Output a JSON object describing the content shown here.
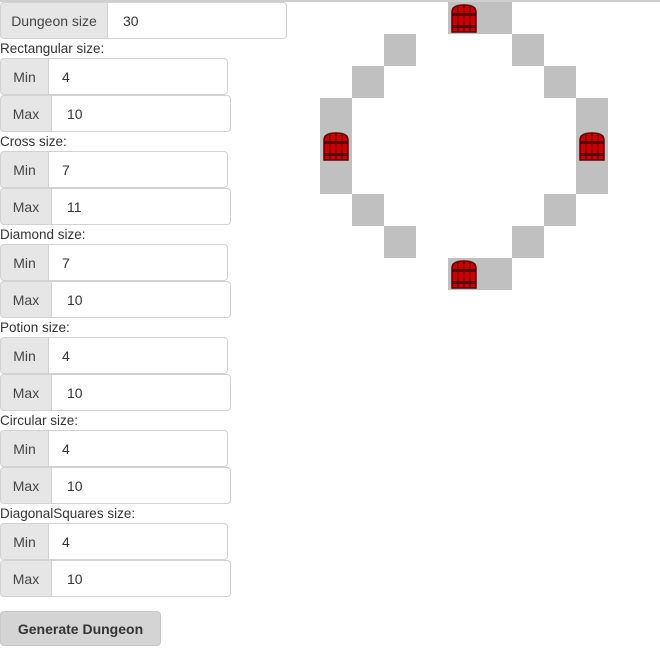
{
  "dungeon": {
    "label": "Dungeon size",
    "value": "30"
  },
  "shapes": [
    {
      "label": "Rectangular size:",
      "min_label": "Min",
      "min": "4",
      "max_label": "Max",
      "max": "10"
    },
    {
      "label": "Cross size:",
      "min_label": "Min",
      "min": "7",
      "max_label": "Max",
      "max": "11"
    },
    {
      "label": "Diamond size:",
      "min_label": "Min",
      "min": "7",
      "max_label": "Max",
      "max": "10"
    },
    {
      "label": "Potion size:",
      "min_label": "Min",
      "min": "4",
      "max_label": "Max",
      "max": "10"
    },
    {
      "label": "Circular size:",
      "min_label": "Min",
      "min": "4",
      "max_label": "Max",
      "max": "10"
    },
    {
      "label": "DiagonalSquares size:",
      "min_label": "Min",
      "min": "4",
      "max_label": "Max",
      "max": "10"
    }
  ],
  "button": {
    "label": "Generate Dungeon"
  },
  "map": {
    "tiles": [
      [
        4,
        0
      ],
      [
        5,
        0
      ],
      [
        2,
        1
      ],
      [
        6,
        1
      ],
      [
        1,
        2
      ],
      [
        7,
        2
      ],
      [
        0,
        3
      ],
      [
        8,
        3
      ],
      [
        0,
        5
      ],
      [
        8,
        5
      ],
      [
        1,
        6
      ],
      [
        7,
        6
      ],
      [
        2,
        7
      ],
      [
        6,
        7
      ],
      [
        4,
        8
      ],
      [
        5,
        8
      ]
    ],
    "doors": [
      [
        4,
        0
      ],
      [
        0,
        4
      ],
      [
        8,
        4
      ],
      [
        4,
        8
      ]
    ],
    "colors": {
      "wall": "#c0c0c0",
      "door": "#cc0000",
      "door_dark": "#5a0000"
    }
  }
}
